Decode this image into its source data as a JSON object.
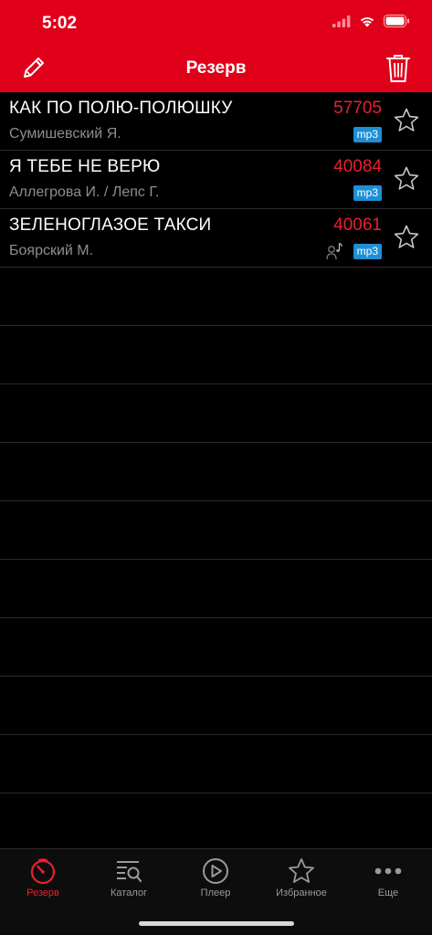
{
  "status": {
    "time": "5:02"
  },
  "nav": {
    "title": "Резерв",
    "edit_icon": "pencil-icon",
    "trash_icon": "trash-icon"
  },
  "colors": {
    "header": "#e0001a",
    "accent": "#e8212f",
    "badge": "#1e8fd6"
  },
  "songs": [
    {
      "title": "КАК ПО ПОЛЮ-ПОЛЮШКУ",
      "artist": "Сумишевский Я.",
      "number": "57705",
      "format": "mp3",
      "has_vocal": false
    },
    {
      "title": "Я ТЕБЕ НЕ ВЕРЮ",
      "artist": "Аллегрова И. / Лепс Г.",
      "number": "40084",
      "format": "mp3",
      "has_vocal": false
    },
    {
      "title": "ЗЕЛЕНОГЛАЗОЕ ТАКСИ",
      "artist": "Боярский М.",
      "number": "40061",
      "format": "mp3",
      "has_vocal": true
    }
  ],
  "tabs": [
    {
      "label": "Резерв",
      "icon": "timer-icon",
      "active": true
    },
    {
      "label": "Каталог",
      "icon": "catalog-search-icon",
      "active": false
    },
    {
      "label": "Плеер",
      "icon": "play-icon",
      "active": false
    },
    {
      "label": "Избранное",
      "icon": "star-icon",
      "active": false
    },
    {
      "label": "Еще",
      "icon": "more-icon",
      "active": false
    }
  ]
}
